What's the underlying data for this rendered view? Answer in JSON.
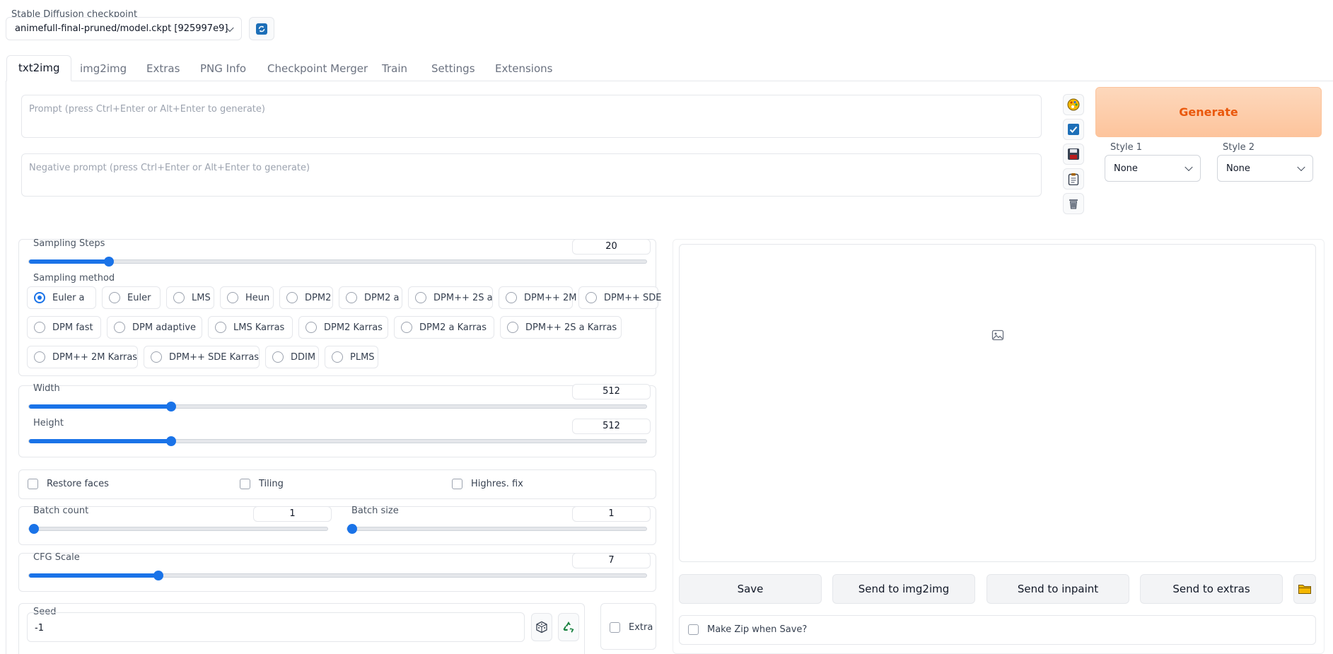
{
  "checkpoint": {
    "label": "Stable Diffusion checkpoint",
    "value": "animefull-final-pruned/model.ckpt [925997e9]"
  },
  "tabs": [
    "txt2img",
    "img2img",
    "Extras",
    "PNG Info",
    "Checkpoint Merger",
    "Train",
    "Settings",
    "Extensions"
  ],
  "prompt": {
    "placeholder": "Prompt (press Ctrl+Enter or Alt+Enter to generate)"
  },
  "negative_prompt": {
    "placeholder": "Negative prompt (press Ctrl+Enter or Alt+Enter to generate)"
  },
  "generate_label": "Generate",
  "styles": [
    {
      "label": "Style 1",
      "value": "None"
    },
    {
      "label": "Style 2",
      "value": "None"
    }
  ],
  "sampling_steps": {
    "label": "Sampling Steps",
    "value": "20",
    "fraction": 0.13
  },
  "sampling_method": {
    "label": "Sampling method",
    "selected": "Euler a",
    "rows": [
      [
        "Euler a",
        "Euler",
        "LMS",
        "Heun",
        "DPM2",
        "DPM2 a",
        "DPM++ 2S a",
        "DPM++ 2M",
        "DPM++ SDE"
      ],
      [
        "DPM fast",
        "DPM adaptive",
        "LMS Karras",
        "DPM2 Karras",
        "DPM2 a Karras",
        "DPM++ 2S a Karras"
      ],
      [
        "DPM++ 2M Karras",
        "DPM++ SDE Karras",
        "DDIM",
        "PLMS"
      ]
    ]
  },
  "width": {
    "label": "Width",
    "value": "512",
    "fraction": 0.23
  },
  "height": {
    "label": "Height",
    "value": "512",
    "fraction": 0.23
  },
  "options": [
    "Restore faces",
    "Tiling",
    "Highres. fix"
  ],
  "batch_count": {
    "label": "Batch count",
    "value": "1",
    "fraction": 0.0
  },
  "batch_size": {
    "label": "Batch size",
    "value": "1",
    "fraction": 0.0
  },
  "cfg_scale": {
    "label": "CFG Scale",
    "value": "7",
    "fraction": 0.21
  },
  "seed": {
    "label": "Seed",
    "value": "-1"
  },
  "extra_label": "Extra",
  "output_buttons": [
    "Save",
    "Send to img2img",
    "Send to inpaint",
    "Send to extras"
  ],
  "make_zip_label": "Make Zip when Save?",
  "colors": {
    "accent": "#1a73e8",
    "generate_bg": "#fdc9a4",
    "generate_text": "#ea580c"
  }
}
